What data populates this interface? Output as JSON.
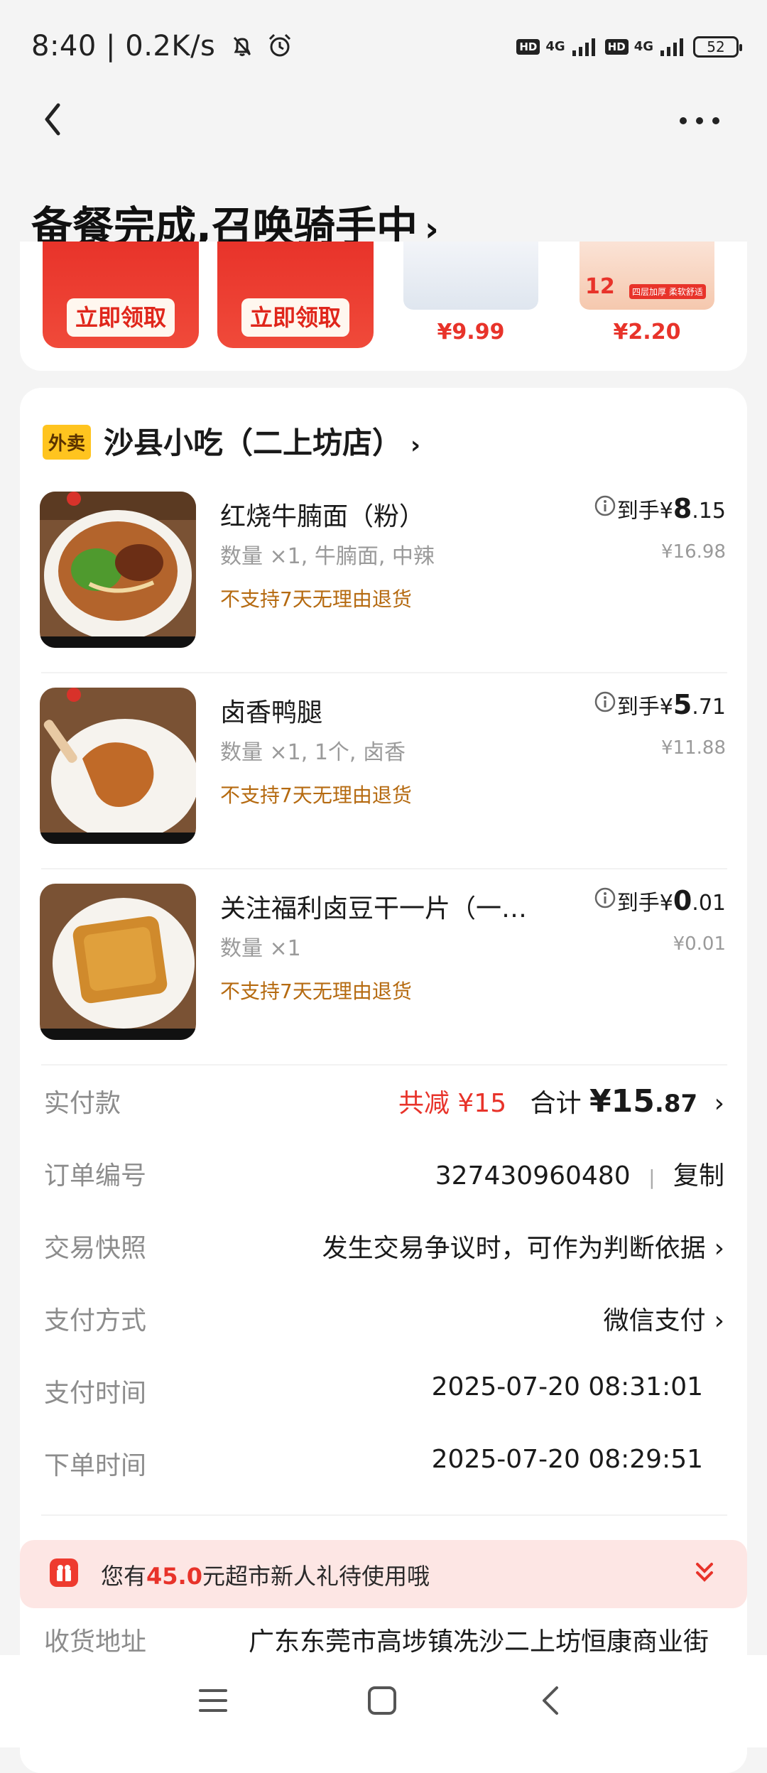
{
  "status_bar": {
    "time": "8:40",
    "speed": "| 0.2K/s",
    "hd": "HD",
    "net": "4G",
    "battery": "52"
  },
  "header": {
    "title": "备餐完成,召唤骑手中",
    "chevron": "›"
  },
  "promo": {
    "coupon_label": "立即领取",
    "products": [
      {
        "price": "¥9.99"
      },
      {
        "price": "¥2.20"
      }
    ],
    "product2_tag": "12",
    "product2_sub": "四层加厚 柔软舒适"
  },
  "store": {
    "tag": "外卖",
    "name": "沙县小吃（二上坊店）",
    "chevron": "›"
  },
  "items": [
    {
      "name": "红烧牛腩面（粉）",
      "spec": "数量 ×1, 牛腩面, 中辣",
      "note": "不支持7天无理由退货",
      "price_prefix": "到手¥",
      "price_int": "8",
      "price_dec": ".15",
      "original": "¥16.98"
    },
    {
      "name": "卤香鸭腿",
      "spec": "数量 ×1, 1个, 卤香",
      "note": "不支持7天无理由退货",
      "price_prefix": "到手¥",
      "price_int": "5",
      "price_dec": ".71",
      "original": "¥11.88"
    },
    {
      "name": "关注福利卤豆干一片（一…",
      "spec": "数量 ×1",
      "note": "不支持7天无理由退货",
      "price_prefix": "到手¥",
      "price_int": "0",
      "price_dec": ".01",
      "original": "¥0.01"
    }
  ],
  "summary": {
    "paid_label": "实付款",
    "discount": "共减 ¥15",
    "total_label": "合计",
    "total_int": "¥15",
    "total_dec": ".87",
    "order_label": "订单编号",
    "order_no": "327430960480",
    "copy": "复制",
    "snapshot_label": "交易快照",
    "snapshot_value": "发生交易争议时，可作为判断依据",
    "pay_method_label": "支付方式",
    "pay_method": "微信支付",
    "pay_time_label": "支付时间",
    "pay_time": "2025-07-20 08:31:01",
    "order_time_label": "下单时间",
    "order_time": "2025-07-20 08:29:51",
    "chevron": "›"
  },
  "banner": {
    "prefix": "您有",
    "amount": "45.0",
    "suffix": "元超市新人礼待使用哦"
  },
  "address": {
    "label": "收货地址",
    "value": "广东东莞市高埗镇冼沙二上坊恒康商业街"
  },
  "colors": {
    "accent_red": "#e8332a",
    "store_tag_yellow": "#ffc41f",
    "note_orange": "#b56a10"
  }
}
